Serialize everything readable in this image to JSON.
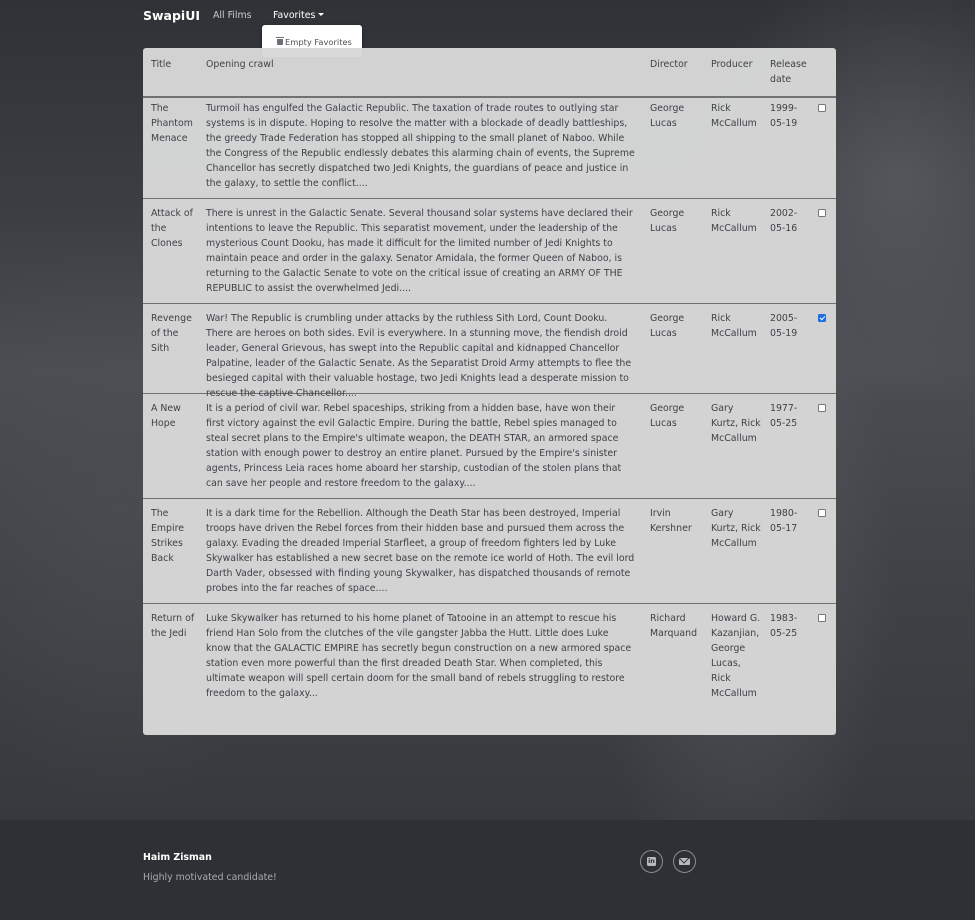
{
  "navbar": {
    "brand": "SwapiUI",
    "all_films": "All Films",
    "favorites": "Favorites",
    "dropdown_item": "Empty Favorites"
  },
  "table": {
    "headers": [
      "Title",
      "Opening crawl",
      "Director",
      "Producer",
      "Release date"
    ],
    "rows": [
      {
        "title": "The Phantom Menace",
        "crawl": "Turmoil has engulfed the Galactic Republic. The taxation of trade routes to outlying star systems is in dispute. Hoping to resolve the matter with a blockade of deadly battleships, the greedy Trade Federation has stopped all shipping to the small planet of Naboo. While the Congress of the Republic endlessly debates this alarming chain of events, the Supreme Chancellor has secretly dispatched two Jedi Knights, the guardians of peace and justice in the galaxy, to settle the conflict....",
        "director": "George Lucas",
        "producer": "Rick McCallum",
        "release_date": "1999-05-19",
        "favorite": false
      },
      {
        "title": "Attack of the Clones",
        "crawl": "There is unrest in the Galactic Senate. Several thousand solar systems have declared their intentions to leave the Republic. This separatist movement, under the leadership of the mysterious Count Dooku, has made it difficult for the limited number of Jedi Knights to maintain peace and order in the galaxy. Senator Amidala, the former Queen of Naboo, is returning to the Galactic Senate to vote on the critical issue of creating an ARMY OF THE REPUBLIC to assist the overwhelmed Jedi....",
        "director": "George Lucas",
        "producer": "Rick McCallum",
        "release_date": "2002-05-16",
        "favorite": false
      },
      {
        "title": "Revenge of the Sith",
        "crawl": "War! The Republic is crumbling under attacks by the ruthless Sith Lord, Count Dooku. There are heroes on both sides. Evil is everywhere. In a stunning move, the fiendish droid leader, General Grievous, has swept into the Republic capital and kidnapped Chancellor Palpatine, leader of the Galactic Senate. As the Separatist Droid Army attempts to flee the besieged capital with their valuable hostage, two Jedi Knights lead a desperate mission to rescue the captive Chancellor....",
        "director": "George Lucas",
        "producer": "Rick McCallum",
        "release_date": "2005-05-19",
        "favorite": true
      },
      {
        "title": "A New Hope",
        "crawl": "It is a period of civil war. Rebel spaceships, striking from a hidden base, have won their first victory against the evil Galactic Empire. During the battle, Rebel spies managed to steal secret plans to the Empire's ultimate weapon, the DEATH STAR, an armored space station with enough power to destroy an entire planet. Pursued by the Empire's sinister agents, Princess Leia races home aboard her starship, custodian of the stolen plans that can save her people and restore freedom to the galaxy....",
        "director": "George Lucas",
        "producer": "Gary Kurtz, Rick McCallum",
        "release_date": "1977-05-25",
        "favorite": false
      },
      {
        "title": "The Empire Strikes Back",
        "crawl": "It is a dark time for the Rebellion. Although the Death Star has been destroyed, Imperial troops have driven the Rebel forces from their hidden base and pursued them across the galaxy. Evading the dreaded Imperial Starfleet, a group of freedom fighters led by Luke Skywalker has established a new secret base on the remote ice world of Hoth. The evil lord Darth Vader, obsessed with finding young Skywalker, has dispatched thousands of remote probes into the far reaches of space....",
        "director": "Irvin Kershner",
        "producer": "Gary Kurtz, Rick McCallum",
        "release_date": "1980-05-17",
        "favorite": false
      },
      {
        "title": "Return of the Jedi",
        "crawl": "Luke Skywalker has returned to his home planet of Tatooine in an attempt to rescue his friend Han Solo from the clutches of the vile gangster Jabba the Hutt. Little does Luke know that the GALACTIC EMPIRE has secretly begun construction on a new armored space station even more powerful than the first dreaded Death Star. When completed, this ultimate weapon will spell certain doom for the small band of rebels struggling to restore freedom to the galaxy...",
        "director": "Richard Marquand",
        "producer": "Howard G. Kazanjian, George Lucas, Rick McCallum",
        "release_date": "1983-05-25",
        "favorite": false
      }
    ]
  },
  "footer": {
    "name": "Haim Zisman",
    "tagline": "Highly motivated candidate!",
    "icons": [
      "linkedin-icon",
      "mail-icon"
    ]
  }
}
